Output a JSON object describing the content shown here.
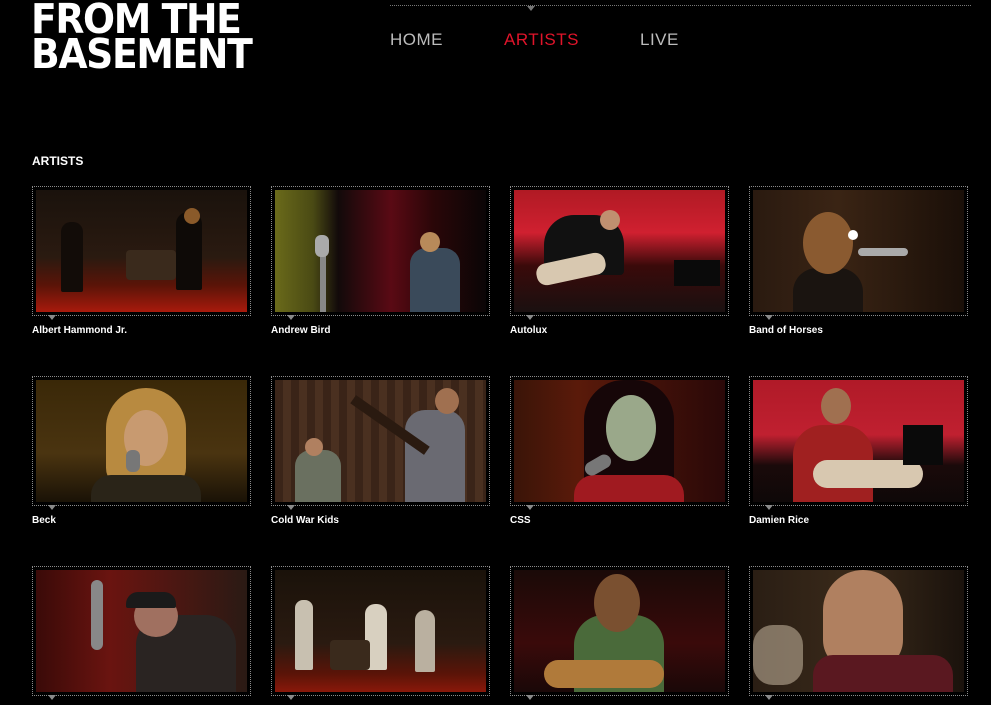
{
  "logo": {
    "line1": "FROM THE",
    "line2": "BASEMENT"
  },
  "nav": {
    "items": [
      {
        "label": "HOME",
        "active": false
      },
      {
        "label": "ARTISTS",
        "active": true
      },
      {
        "label": "LIVE",
        "active": false
      }
    ]
  },
  "section": {
    "title": "ARTISTS"
  },
  "artists": [
    {
      "name": "Albert Hammond Jr."
    },
    {
      "name": "Andrew Bird"
    },
    {
      "name": "Autolux"
    },
    {
      "name": "Band of Horses"
    },
    {
      "name": "Beck"
    },
    {
      "name": "Cold War Kids"
    },
    {
      "name": "CSS"
    },
    {
      "name": "Damien Rice"
    },
    {
      "name": ""
    },
    {
      "name": ""
    },
    {
      "name": ""
    },
    {
      "name": ""
    }
  ],
  "colors": {
    "accent": "#e0142a",
    "nav_text": "#bcbcbc",
    "background": "#000000"
  }
}
